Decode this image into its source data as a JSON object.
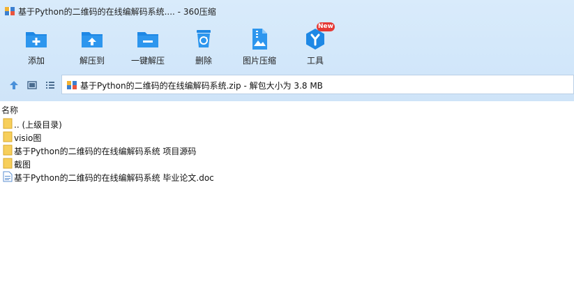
{
  "window": {
    "title": "基于Python的二维码的在线编解码系统.... - 360压缩"
  },
  "toolbar": {
    "buttons": [
      {
        "label": "添加",
        "icon": "folder-add-icon"
      },
      {
        "label": "解压到",
        "icon": "folder-extract-icon"
      },
      {
        "label": "一键解压",
        "icon": "folder-one-click-extract-icon"
      },
      {
        "label": "删除",
        "icon": "trash-icon"
      },
      {
        "label": "图片压缩",
        "icon": "image-compress-icon"
      },
      {
        "label": "工具",
        "icon": "tools-icon"
      }
    ],
    "new_badge": "New"
  },
  "nav": {
    "path": "基于Python的二维码的在线编解码系统.zip - 解包大小为 3.8 MB"
  },
  "file_list": {
    "column_name": "名称",
    "items": [
      {
        "name": ".. (上级目录)",
        "type": "folder"
      },
      {
        "name": "visio图",
        "type": "folder"
      },
      {
        "name": "基于Python的二维码的在线编解码系统 项目源码",
        "type": "folder"
      },
      {
        "name": "截图",
        "type": "folder"
      },
      {
        "name": "基于Python的二维码的在线编解码系统 毕业论文.doc",
        "type": "doc"
      }
    ]
  },
  "colors": {
    "toolbar_bg": "#d2e7fa",
    "icon_blue": "#1e88e5",
    "folder_yellow": "#f7cf5b",
    "badge_red": "#e53935"
  }
}
